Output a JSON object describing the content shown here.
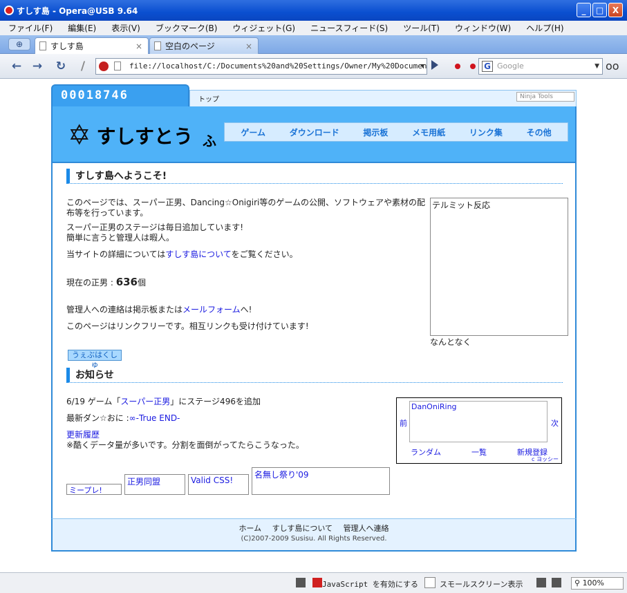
{
  "window": {
    "title": "すしす島 - Opera@USB 9.64",
    "buttons": {
      "min": "_",
      "max": "□",
      "close": "X"
    }
  },
  "menu": [
    "ファイル(F)",
    "編集(E)",
    "表示(V)",
    "ブックマーク(B)",
    "ウィジェット(G)",
    "ニュースフィード(S)",
    "ツール(T)",
    "ウィンドウ(W)",
    "ヘルプ(H)"
  ],
  "tabs": [
    {
      "label": "すしす島",
      "close": "×"
    },
    {
      "label": "空白のページ",
      "close": "×"
    }
  ],
  "newtab": "⊕",
  "toolbar": {
    "back": "←",
    "forward": "→",
    "reload": "↻",
    "edit": "/"
  },
  "address": {
    "url": "file://localhost/C:/Documents%20and%20Settings/Owner/My%20Documents/N"
  },
  "search": {
    "engine_icon": "G",
    "placeholder": "Google"
  },
  "glasses": "oo",
  "site": {
    "counter": "00018746",
    "top_tab": "トップ",
    "ninja": "Ninja Tools",
    "logo_mark": "✡",
    "logo_text": "すしすとう",
    "logo_sub": "ふ",
    "nav": [
      "ゲーム",
      "ダウンロード",
      "掲示板",
      "メモ用紙",
      "リンク集",
      "その他"
    ],
    "welcome": {
      "heading": "すしす島へようこそ!",
      "p1": "このページでは、スーパー正男、Dancing☆Onigiri等のゲームの公開、ソフトウェアや素材の配布等を行っています。",
      "p2a": "スーパー正男のステージは毎日追加しています!",
      "p2b": "簡単に言うと管理人は暇人。",
      "p3_pre": "当サイトの詳細については",
      "p3_link": "すしす島について",
      "p3_post": "をご覧ください。",
      "count_pre": "現在の正男 : ",
      "count_val": "636",
      "count_post": "個",
      "contact_pre": "管理人への連絡は掲示板または",
      "contact_link": "メールフォーム",
      "contact_post": "へ!",
      "linkfree": "このページはリンクフリーです。相互リンクも受け付けています!",
      "frame_text": "テルミット反応",
      "frame_caption": "なんとなく",
      "web_clap": "うぇぶはくしゅ"
    },
    "news": {
      "heading": "お知らせ",
      "item1_pre": "6/19 ゲーム「",
      "item1_link": "スーパー正男",
      "item1_post": "」にステージ496を追加",
      "item2_pre": "最新ダン☆おに :",
      "item2_link": "∞-True END-",
      "history_link": "更新履歴",
      "history_note": "※酷くデータ量が多いです。分割を面倒がってたらこうなった。"
    },
    "ring": {
      "name": "DanOniRing",
      "prev": "前",
      "next": "次",
      "random": "ランダム",
      "list": "一覧",
      "register": "新規登録",
      "credit": "c ヨッシー"
    },
    "banners": [
      "ミープレ!",
      "正男同盟",
      "Valid CSS!",
      "名無し祭り'09"
    ],
    "footer": {
      "links": [
        "ホーム",
        "すしす島について",
        "管理人へ連絡"
      ],
      "copyright": "(C)2007-2009 Susisu. All Rights Reserved."
    }
  },
  "status": {
    "javascript": "JavaScript を有効にする",
    "small_screen": "スモールスクリーン表示",
    "zoom": "100%"
  }
}
